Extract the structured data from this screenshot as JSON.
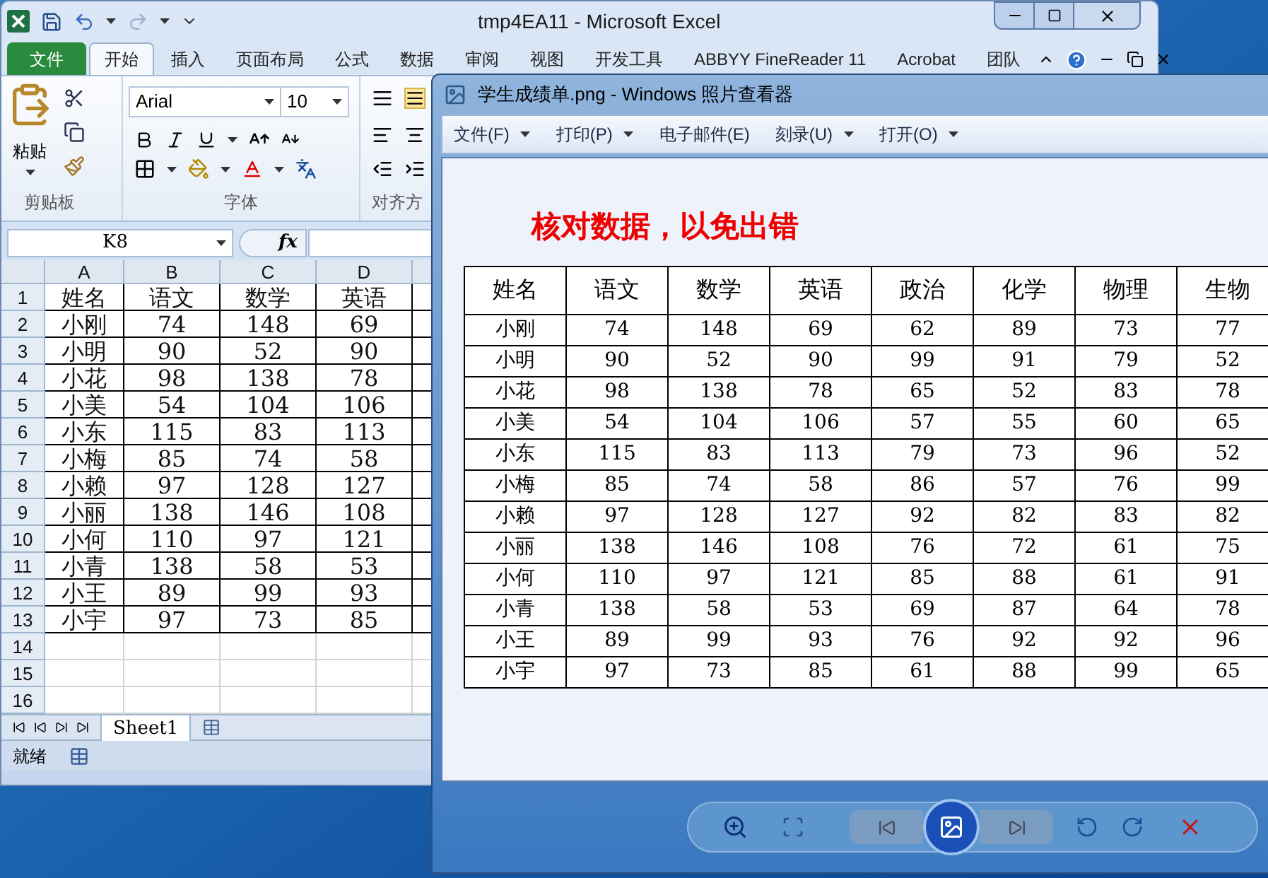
{
  "excel": {
    "title": "tmp4EA11  -  Microsoft Excel",
    "tabs": [
      {
        "label": "文件",
        "kind": "file",
        "selected": false
      },
      {
        "label": "开始",
        "kind": "tab",
        "selected": true
      },
      {
        "label": "插入",
        "kind": "tab",
        "selected": false
      },
      {
        "label": "页面布局",
        "kind": "tab",
        "selected": false
      },
      {
        "label": "公式",
        "kind": "tab",
        "selected": false
      },
      {
        "label": "数据",
        "kind": "tab",
        "selected": false
      },
      {
        "label": "审阅",
        "kind": "tab",
        "selected": false
      },
      {
        "label": "视图",
        "kind": "tab",
        "selected": false
      },
      {
        "label": "开发工具",
        "kind": "tab",
        "selected": false
      },
      {
        "label": "ABBYY FineReader 11",
        "kind": "tab",
        "selected": false
      },
      {
        "label": "Acrobat",
        "kind": "tab",
        "selected": false
      },
      {
        "label": "团队",
        "kind": "tab",
        "selected": false
      }
    ],
    "ribbon": {
      "paste_label": "粘贴",
      "font_name": "Arial",
      "font_size": "10",
      "groups": [
        "剪贴板",
        "字体",
        "对齐方"
      ]
    },
    "name_box": "K8",
    "function_label": "fx",
    "columns": [
      "A",
      "B",
      "C",
      "D"
    ],
    "rows": [
      {
        "number": "1",
        "cells": [
          "姓名",
          "语文",
          "数学",
          "英语"
        ]
      },
      {
        "number": "2",
        "cells": [
          "小刚",
          "74",
          "148",
          "69"
        ]
      },
      {
        "number": "3",
        "cells": [
          "小明",
          "90",
          "52",
          "90"
        ]
      },
      {
        "number": "4",
        "cells": [
          "小花",
          "98",
          "138",
          "78"
        ]
      },
      {
        "number": "5",
        "cells": [
          "小美",
          "54",
          "104",
          "106"
        ]
      },
      {
        "number": "6",
        "cells": [
          "小东",
          "115",
          "83",
          "113"
        ]
      },
      {
        "number": "7",
        "cells": [
          "小梅",
          "85",
          "74",
          "58"
        ]
      },
      {
        "number": "8",
        "cells": [
          "小赖",
          "97",
          "128",
          "127"
        ]
      },
      {
        "number": "9",
        "cells": [
          "小丽",
          "138",
          "146",
          "108"
        ]
      },
      {
        "number": "10",
        "cells": [
          "小何",
          "110",
          "97",
          "121"
        ]
      },
      {
        "number": "11",
        "cells": [
          "小青",
          "138",
          "58",
          "53"
        ]
      },
      {
        "number": "12",
        "cells": [
          "小王",
          "89",
          "99",
          "93"
        ]
      },
      {
        "number": "13",
        "cells": [
          "小宇",
          "97",
          "73",
          "85"
        ]
      }
    ],
    "empty_rows": [
      "14",
      "15",
      "16"
    ],
    "sheet_tabs": [
      {
        "label": "Sheet1",
        "selected": true
      }
    ],
    "status": "就绪"
  },
  "viewer": {
    "title": "学生成绩单.png - Windows 照片查看器",
    "menu": [
      {
        "label": "文件(F)",
        "has_menu": true
      },
      {
        "label": "打印(P)",
        "has_menu": true
      },
      {
        "label": "电子邮件(E)",
        "has_menu": false
      },
      {
        "label": "刻录(U)",
        "has_menu": true
      },
      {
        "label": "打开(O)",
        "has_menu": true
      }
    ],
    "image": {
      "heading": "核对数据，以免出错",
      "columns": [
        "姓名",
        "语文",
        "数学",
        "英语",
        "政治",
        "化学",
        "物理",
        "生物"
      ],
      "rows": [
        [
          "小刚",
          "74",
          "148",
          "69",
          "62",
          "89",
          "73",
          "77"
        ],
        [
          "小明",
          "90",
          "52",
          "90",
          "99",
          "91",
          "79",
          "52"
        ],
        [
          "小花",
          "98",
          "138",
          "78",
          "65",
          "52",
          "83",
          "78"
        ],
        [
          "小美",
          "54",
          "104",
          "106",
          "57",
          "55",
          "60",
          "65"
        ],
        [
          "小东",
          "115",
          "83",
          "113",
          "79",
          "73",
          "96",
          "52"
        ],
        [
          "小梅",
          "85",
          "74",
          "58",
          "86",
          "57",
          "76",
          "99"
        ],
        [
          "小赖",
          "97",
          "128",
          "127",
          "92",
          "82",
          "83",
          "82"
        ],
        [
          "小丽",
          "138",
          "146",
          "108",
          "76",
          "72",
          "61",
          "75"
        ],
        [
          "小何",
          "110",
          "97",
          "121",
          "85",
          "88",
          "61",
          "91"
        ],
        [
          "小青",
          "138",
          "58",
          "53",
          "69",
          "87",
          "64",
          "78"
        ],
        [
          "小王",
          "89",
          "99",
          "93",
          "76",
          "92",
          "92",
          "96"
        ],
        [
          "小宇",
          "97",
          "73",
          "85",
          "61",
          "88",
          "99",
          "65"
        ]
      ]
    }
  }
}
